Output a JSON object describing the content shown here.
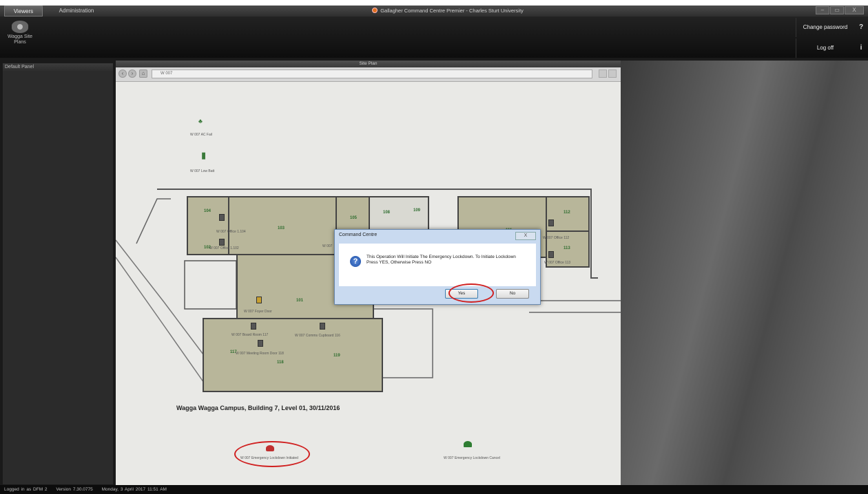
{
  "titlebar": {
    "tabs": [
      "Viewers",
      "Administration"
    ],
    "window_title": "Gallagher Command Centre Premier - Charles Sturt University",
    "controls": [
      "–",
      "▭",
      "X"
    ]
  },
  "toolbar": {
    "site_button_label": "Wagga Site Plans",
    "change_password": "Change password",
    "log_off": "Log off",
    "help_icon": "?",
    "info_icon": "i"
  },
  "left_panel": {
    "title": "Default Panel"
  },
  "site_plan": {
    "header": "Site Plan",
    "address": "W 007",
    "caption": "Wagga Wagga Campus, Building 7, Level 01, 30/11/2016",
    "rooms": [
      "104",
      "103",
      "105",
      "108",
      "109",
      "111",
      "112",
      "113",
      "101",
      "117",
      "118",
      "119",
      "102"
    ],
    "labels": {
      "ac_fail": "W 007 AC Fail",
      "low_batt": "W 007 Low Batt",
      "office_104": "W 007 Office 1.104",
      "office_102": "W 007 Office 1.102",
      "foyer": "W 007 Foyer Door",
      "board_room": "W 007 Board Room 117",
      "meeting": "W 007 Meeting Room Door 118",
      "comms": "W 007 Comms Cupboard 116",
      "office_112": "W 007 Office 112",
      "office_113": "W 007 Office 113",
      "w007": "W 007",
      "lockdown_initiated": "W 007 Emergency Lockdown Initiated",
      "lockdown_cancel": "W 007 Emergency Lockdown Cancel"
    }
  },
  "dialog": {
    "title": "Command Centre",
    "close": "X",
    "message": "This Operation Will Initiate The Emergency Lockdown. To Initiate Lockdown Press YES, Otherwise Press NO",
    "yes": "Yes",
    "no": "No",
    "icon": "?"
  },
  "status": {
    "user": "Logged in as DFM 2",
    "version": "Version 7.30.0775",
    "date": "Monday, 3 April 2017 11:51 AM"
  },
  "colors": {
    "highlight_ellipse": "#d02020",
    "lockdown_initiated": "#c03030",
    "lockdown_cancel": "#2e7d32"
  }
}
